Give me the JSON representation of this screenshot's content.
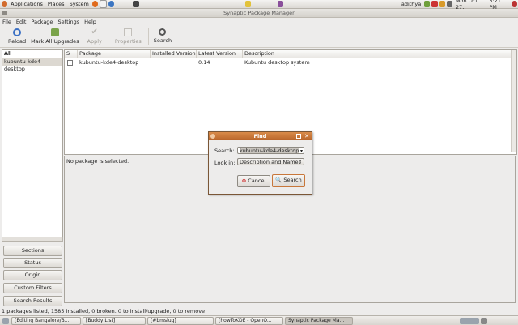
{
  "top_panel": {
    "menus": [
      "Applications",
      "Places",
      "System"
    ],
    "user": "adithya",
    "datetime": "Mon Oct 27,",
    "clock": "3:21 PM"
  },
  "window": {
    "title": "Synaptic Package Manager"
  },
  "menubar": [
    "File",
    "Edit",
    "Package",
    "Settings",
    "Help"
  ],
  "toolbar": {
    "reload": "Reload",
    "mark_all": "Mark All Upgrades",
    "apply": "Apply",
    "properties": "Properties",
    "search": "Search"
  },
  "left_pane": {
    "header": "All",
    "items": [
      "kubuntu-kde4-desktop"
    ],
    "buttons": [
      "Sections",
      "Status",
      "Origin",
      "Custom Filters",
      "Search Results"
    ]
  },
  "package_table": {
    "columns": [
      "S",
      "Package",
      "Installed Version",
      "Latest Version",
      "Description"
    ],
    "rows": [
      {
        "package": "kubuntu-kde4-desktop",
        "installed": "",
        "latest": "0.14",
        "description": "Kubuntu desktop system"
      }
    ]
  },
  "details": {
    "text": "No package is selected."
  },
  "statusbar": "1 packages listed, 1585 installed, 0 broken. 0 to install/upgrade, 0 to remove",
  "taskbar": [
    "[Editing Bangalore/B...",
    "[Buddy List]",
    "[#bmslug]",
    "[howToKDE - OpenO...",
    "Synaptic Package Ma..."
  ],
  "find_dialog": {
    "title": "Find",
    "search_label": "Search:",
    "search_value": "kubuntu-kde4-desktop",
    "lookin_label": "Look in:",
    "lookin_value": "Description and Name",
    "cancel": "Cancel",
    "search_button": "Search"
  },
  "colors": {
    "dialog_title": "#c8773a",
    "panel": "#dcd9d4"
  }
}
